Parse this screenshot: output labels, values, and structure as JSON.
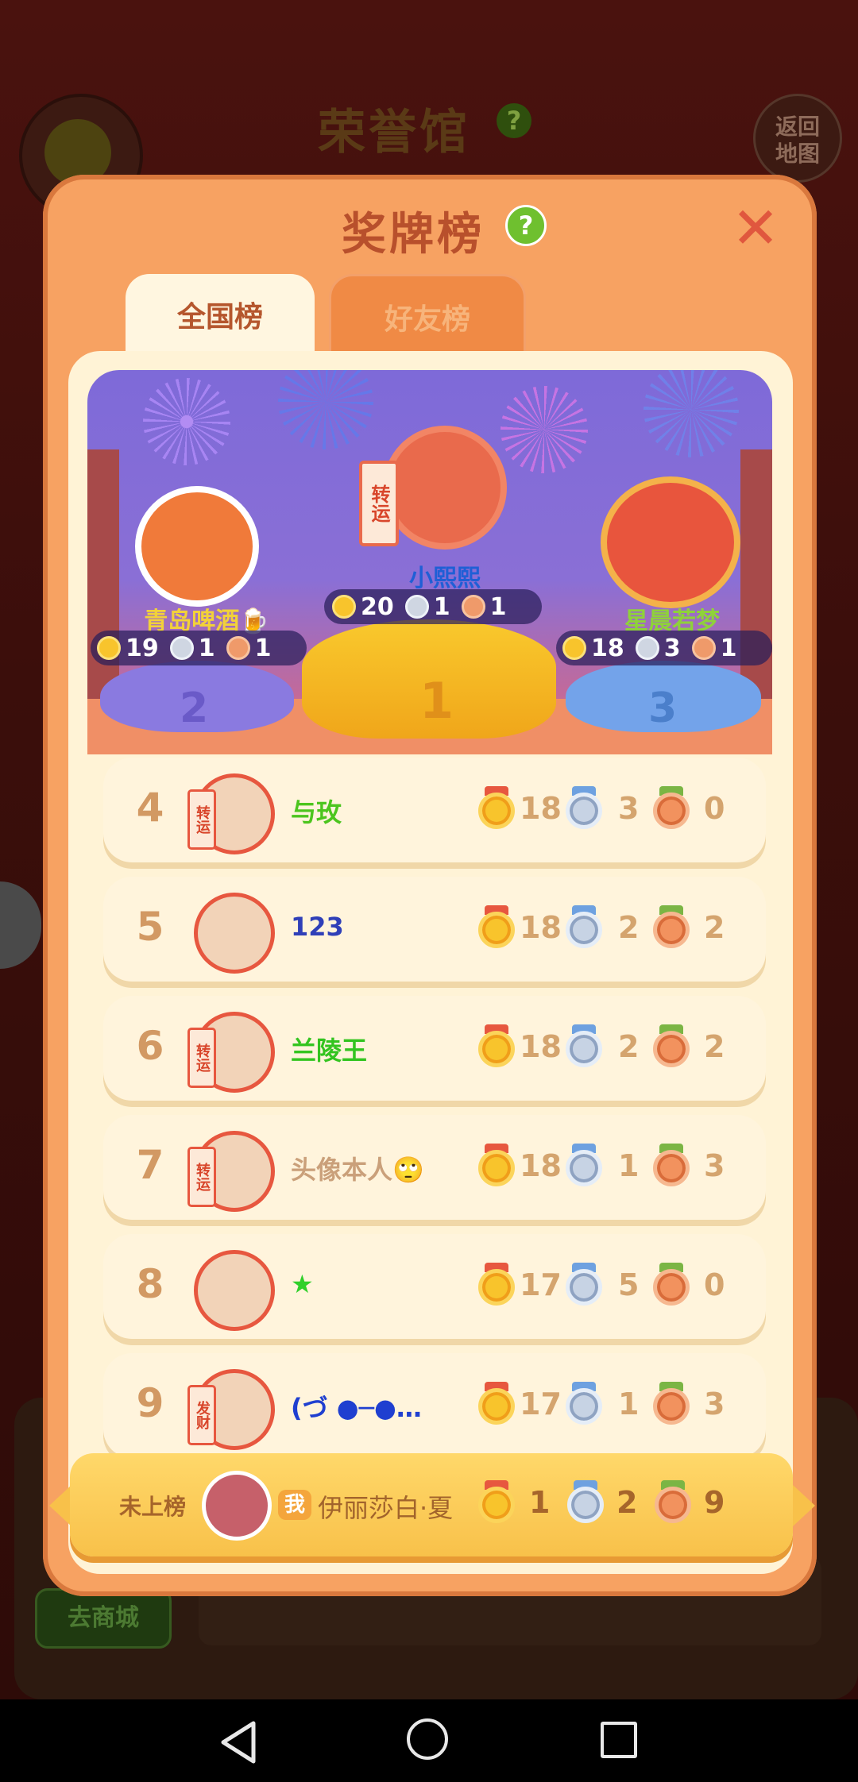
{
  "background": {
    "title": "荣誉馆",
    "help": "?",
    "back_button": "返回地图",
    "shop_button": "去商城"
  },
  "modal": {
    "title": "奖牌榜",
    "help": "?",
    "close": "✕",
    "tabs": [
      {
        "label": "全国榜",
        "active": true
      },
      {
        "label": "好友榜",
        "active": false
      }
    ]
  },
  "podium": [
    {
      "rank": 1,
      "name": "小熙熙",
      "name_color": "#1f5fd6",
      "badge": "转运",
      "gold": "20",
      "silver": "1",
      "bronze": "1"
    },
    {
      "rank": 2,
      "name": "青岛啤酒🍺",
      "name_color": "#f2d13a",
      "gold": "19",
      "silver": "1",
      "bronze": "1"
    },
    {
      "rank": 3,
      "name": "星晨若梦",
      "name_color": "#8fd23a",
      "gold": "18",
      "silver": "3",
      "bronze": "1"
    }
  ],
  "podium_numbers": [
    "1",
    "2",
    "3"
  ],
  "rows": [
    {
      "rank": "4",
      "name": "与玫",
      "name_color": "#4cc51e",
      "badge": "转运",
      "gold": "18",
      "silver": "3",
      "bronze": "0"
    },
    {
      "rank": "5",
      "name": "123",
      "name_color": "#2f3fb8",
      "badge": "",
      "gold": "18",
      "silver": "2",
      "bronze": "2"
    },
    {
      "rank": "6",
      "name": "兰陵王",
      "name_color": "#33c41f",
      "badge": "转运",
      "gold": "18",
      "silver": "2",
      "bronze": "2"
    },
    {
      "rank": "7",
      "name": "头像本人🙄",
      "name_color": "#caa07a",
      "badge": "转运",
      "gold": "18",
      "silver": "1",
      "bronze": "3"
    },
    {
      "rank": "8",
      "name": "★",
      "name_color": "#2fd02a",
      "badge": "",
      "gold": "17",
      "silver": "5",
      "bronze": "0"
    },
    {
      "rank": "9",
      "name": "(づ ●─●…",
      "name_color": "#1f3fd0",
      "badge": "发财",
      "gold": "17",
      "silver": "1",
      "bronze": "3"
    }
  ],
  "my_row": {
    "status": "未上榜",
    "me_tag": "我",
    "name": "伊丽莎白·夏",
    "gold": "1",
    "silver": "2",
    "bronze": "9"
  },
  "colors": {
    "modal_bg": "#f7a262",
    "inner_bg": "#fff3d6",
    "accent_title": "#b8502c",
    "help_green": "#6fc02f"
  },
  "icons": {
    "close": "close-icon",
    "help": "help-icon",
    "gold_medal": "gold-medal-icon",
    "silver_medal": "silver-medal-icon",
    "bronze_medal": "bronze-medal-icon",
    "nav_back": "triangle-back-icon",
    "nav_home": "circle-home-icon",
    "nav_recent": "square-recent-icon"
  }
}
